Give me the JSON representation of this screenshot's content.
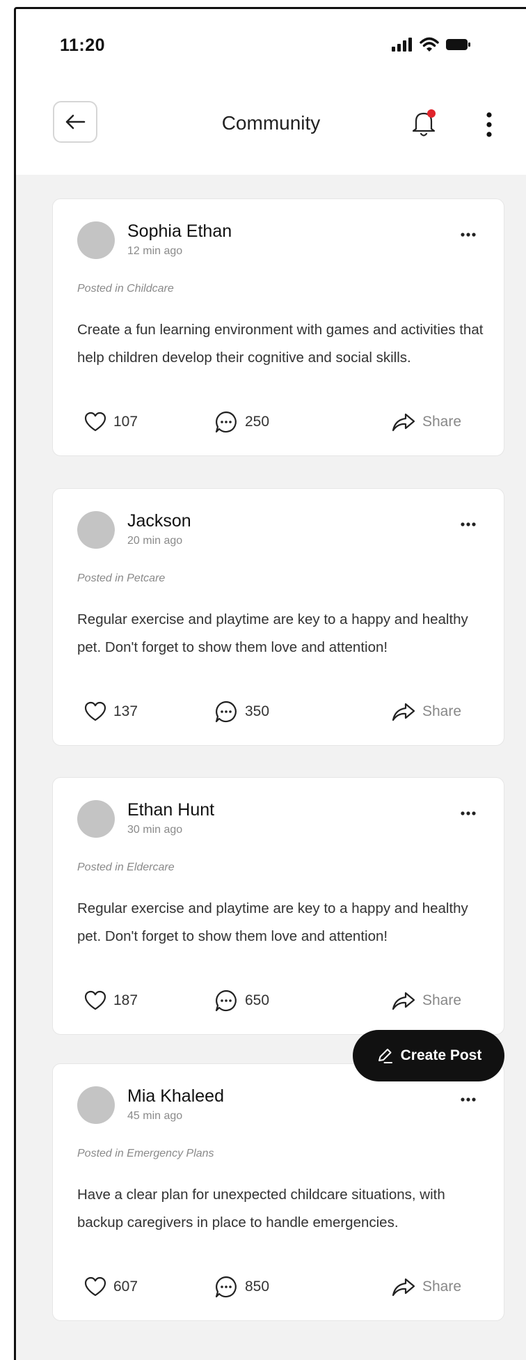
{
  "status_bar": {
    "time": "11:20"
  },
  "header": {
    "title": "Community"
  },
  "posts": [
    {
      "author": "Sophia Ethan",
      "time_ago": "12 min ago",
      "category": "Posted in Childcare",
      "body": "Create a fun learning environment with games and activities that help children develop their cognitive and social skills.",
      "likes": "107",
      "comments": "250",
      "share_label": "Share"
    },
    {
      "author": "Jackson",
      "time_ago": "20 min ago",
      "category": "Posted in Petcare",
      "body": "Regular exercise and playtime are key to a happy and healthy pet. Don't forget to show them love and attention!",
      "likes": "137",
      "comments": "350",
      "share_label": "Share"
    },
    {
      "author": "Ethan Hunt",
      "time_ago": "30 min ago",
      "category": "Posted in Eldercare",
      "body": "Regular exercise and playtime are key to a happy and healthy pet. Don't forget to show them love and attention!",
      "likes": "187",
      "comments": "650",
      "share_label": "Share"
    },
    {
      "author": "Mia Khaleed",
      "time_ago": "45 min ago",
      "category": "Posted in Emergency Plans",
      "body": "Have a clear plan for unexpected childcare situations, with backup caregivers in place to handle emergencies.",
      "likes": "607",
      "comments": "850",
      "share_label": "Share"
    }
  ],
  "fab": {
    "label": "Create Post"
  },
  "colors": {
    "notification_dot": "#e0242b",
    "feed_background": "#f2f2f2",
    "fab_background": "#111111"
  }
}
